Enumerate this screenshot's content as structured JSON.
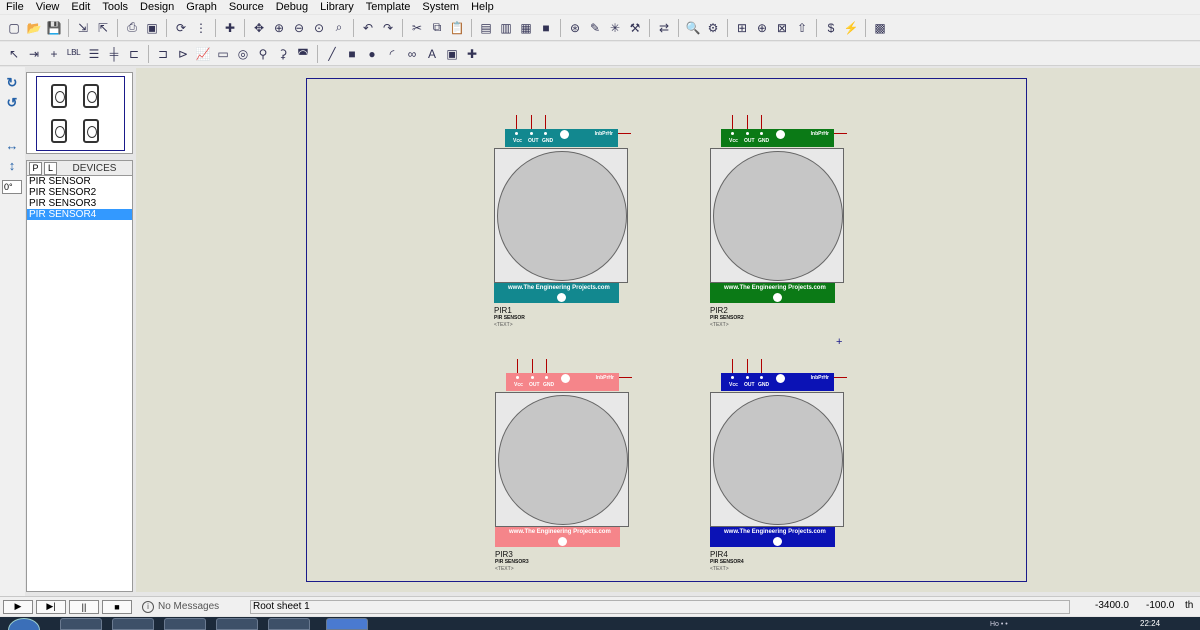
{
  "menu": [
    "File",
    "View",
    "Edit",
    "Tools",
    "Design",
    "Graph",
    "Source",
    "Debug",
    "Library",
    "Template",
    "System",
    "Help"
  ],
  "toolbar1": [
    {
      "name": "new-file-icon",
      "glyph": "▢"
    },
    {
      "name": "open-folder-icon",
      "glyph": "📂"
    },
    {
      "name": "save-icon",
      "glyph": "💾"
    },
    {
      "sep": true
    },
    {
      "name": "import-icon",
      "glyph": "⇲"
    },
    {
      "name": "export-icon",
      "glyph": "⇱"
    },
    {
      "sep": true
    },
    {
      "name": "print-icon",
      "glyph": "⎙"
    },
    {
      "name": "print-area-icon",
      "glyph": "▣"
    },
    {
      "sep": true
    },
    {
      "name": "refresh-icon",
      "glyph": "⟳"
    },
    {
      "name": "grid-icon",
      "glyph": "⋮"
    },
    {
      "sep": true
    },
    {
      "name": "origin-icon",
      "glyph": "✚"
    },
    {
      "sep": true
    },
    {
      "name": "pan-icon",
      "glyph": "✥"
    },
    {
      "name": "zoom-in-icon",
      "glyph": "⊕"
    },
    {
      "name": "zoom-out-icon",
      "glyph": "⊖"
    },
    {
      "name": "zoom-all-icon",
      "glyph": "⊙"
    },
    {
      "name": "zoom-area-icon",
      "glyph": "⌕"
    },
    {
      "sep": true
    },
    {
      "name": "undo-icon",
      "glyph": "↶"
    },
    {
      "name": "redo-icon",
      "glyph": "↷"
    },
    {
      "sep": true
    },
    {
      "name": "cut-icon",
      "glyph": "✂"
    },
    {
      "name": "copy-icon",
      "glyph": "⧉"
    },
    {
      "name": "paste-icon",
      "glyph": "📋"
    },
    {
      "sep": true
    },
    {
      "name": "block-copy-icon",
      "glyph": "▤"
    },
    {
      "name": "block-move-icon",
      "glyph": "▥"
    },
    {
      "name": "block-rotate-icon",
      "glyph": "▦"
    },
    {
      "name": "block-delete-icon",
      "glyph": "■"
    },
    {
      "sep": true
    },
    {
      "name": "pick-device-icon",
      "glyph": "⊛"
    },
    {
      "name": "make-device-icon",
      "glyph": "✎"
    },
    {
      "name": "packaging-tool-icon",
      "glyph": "✳"
    },
    {
      "name": "decompose-icon",
      "glyph": "⚒"
    },
    {
      "sep": true
    },
    {
      "name": "wire-autorouter-icon",
      "glyph": "⇄"
    },
    {
      "sep": true
    },
    {
      "name": "search-tag-icon",
      "glyph": "🔍"
    },
    {
      "name": "property-tool-icon",
      "glyph": "⚙"
    },
    {
      "sep": true
    },
    {
      "name": "new-sheet-icon",
      "glyph": "⊞"
    },
    {
      "name": "add-sheet-icon",
      "glyph": "⊕"
    },
    {
      "name": "remove-sheet-icon",
      "glyph": "⊠"
    },
    {
      "name": "goto-child-icon",
      "glyph": "⇧"
    },
    {
      "sep": true
    },
    {
      "name": "bill-of-materials-icon",
      "glyph": "$"
    },
    {
      "name": "electrical-rules-icon",
      "glyph": "⚡"
    },
    {
      "sep": true
    },
    {
      "name": "ares-icon",
      "glyph": "▩"
    }
  ],
  "toolbar2": [
    {
      "name": "selection-mode-icon",
      "glyph": "↖"
    },
    {
      "name": "component-mode-icon",
      "glyph": "⇥"
    },
    {
      "name": "junction-dot-icon",
      "glyph": "+"
    },
    {
      "name": "wire-label-icon",
      "glyph": "ᴸᴮᴸ"
    },
    {
      "name": "text-script-icon",
      "glyph": "☰"
    },
    {
      "name": "bus-icon",
      "glyph": "╪"
    },
    {
      "name": "subcircuit-icon",
      "glyph": "⊏"
    },
    {
      "sep": true
    },
    {
      "name": "terminal-icon",
      "glyph": "⊐"
    },
    {
      "name": "device-pin-icon",
      "glyph": "⊳"
    },
    {
      "name": "graph-icon",
      "glyph": "📈"
    },
    {
      "name": "tape-recorder-icon",
      "glyph": "▭"
    },
    {
      "name": "generator-icon",
      "glyph": "◎"
    },
    {
      "name": "voltage-probe-icon",
      "glyph": "⚲"
    },
    {
      "name": "current-probe-icon",
      "glyph": "⚳"
    },
    {
      "name": "virtual-instruments-icon",
      "glyph": "◚"
    },
    {
      "sep": true
    },
    {
      "name": "line-icon",
      "glyph": "╱"
    },
    {
      "name": "box-icon",
      "glyph": "■"
    },
    {
      "name": "circle-icon",
      "glyph": "●"
    },
    {
      "name": "arc-icon",
      "glyph": "◜"
    },
    {
      "name": "path-icon",
      "glyph": "∞"
    },
    {
      "name": "text-icon",
      "glyph": "A"
    },
    {
      "name": "symbol-icon",
      "glyph": "▣"
    },
    {
      "name": "marker-icon",
      "glyph": "✚"
    }
  ],
  "left_tools": [
    {
      "name": "rotate-clockwise-icon",
      "glyph": "↻"
    },
    {
      "name": "rotate-anticlockwise-icon",
      "glyph": "↺"
    },
    {
      "name": "mirror-horizontal-icon",
      "glyph": "↔"
    },
    {
      "name": "mirror-vertical-icon",
      "glyph": "↕"
    }
  ],
  "rotation_angle": "0°",
  "devices": {
    "tab_p": "P",
    "tab_l": "L",
    "title": "DEVICES",
    "items": [
      {
        "label": "PIR SENSOR",
        "selected": false
      },
      {
        "label": "PIR SENSOR2",
        "selected": false
      },
      {
        "label": "PIR SENSOR3",
        "selected": false
      },
      {
        "label": "PIR SENSOR4",
        "selected": true
      }
    ]
  },
  "components": [
    {
      "ref": "PIR1",
      "value": "PIR SENSOR",
      "text": "<TEXT>",
      "color": "#12888f"
    },
    {
      "ref": "PIR2",
      "value": "PIR SENSOR2",
      "text": "<TEXT>",
      "color": "#0b7a16"
    },
    {
      "ref": "PIR3",
      "value": "PIR SENSOR3",
      "text": "<TEXT>",
      "color": "#f5858a"
    },
    {
      "ref": "PIR4",
      "value": "PIR SENSOR4",
      "text": "<TEXT>",
      "color": "#0b12b5"
    }
  ],
  "pir_labels": {
    "vcc": "Vcc",
    "out": "OUT",
    "gnd": "GND",
    "logo": "lnbPrHr",
    "website": "www.The Engineering Projects.com"
  },
  "status": {
    "play": "▶",
    "step": "▶|",
    "pause": "||",
    "stop": "■",
    "messages": "No Messages",
    "sheet": "Root sheet 1",
    "coord_x": "-3400.0",
    "coord_y": "-100.0",
    "unit": "th"
  },
  "taskbar": {
    "clock": "22:24",
    "tray_text": "Ho • •"
  }
}
